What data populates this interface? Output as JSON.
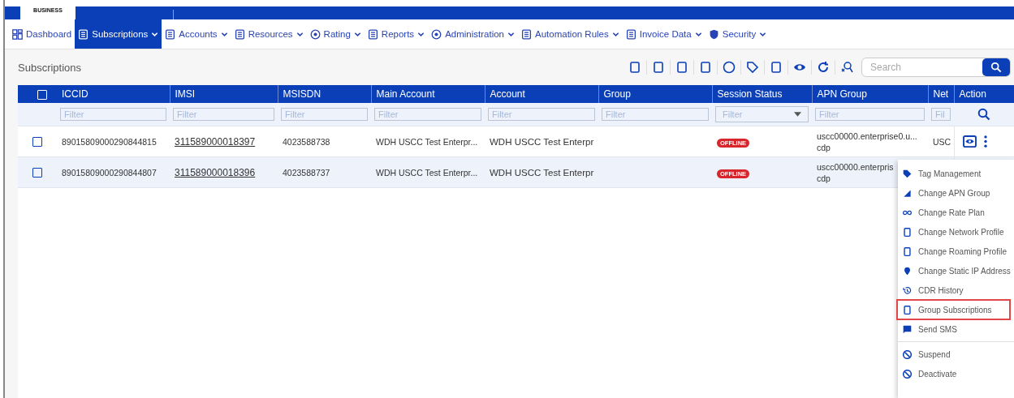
{
  "header": {
    "logo_text": "BUSINESS"
  },
  "nav": [
    {
      "label": "Dashboard",
      "selected": false,
      "has_menu": false
    },
    {
      "label": "Subscriptions",
      "selected": true,
      "has_menu": true
    },
    {
      "label": "Accounts",
      "selected": false,
      "has_menu": true
    },
    {
      "label": "Resources",
      "selected": false,
      "has_menu": true
    },
    {
      "label": "Rating",
      "selected": false,
      "has_menu": true
    },
    {
      "label": "Reports",
      "selected": false,
      "has_menu": true
    },
    {
      "label": "Administration",
      "selected": false,
      "has_menu": true
    },
    {
      "label": "Automation Rules",
      "selected": false,
      "has_menu": true
    },
    {
      "label": "Invoice Data",
      "selected": false,
      "has_menu": true
    },
    {
      "label": "Security",
      "selected": false,
      "has_menu": true
    }
  ],
  "panel": {
    "title": "Subscriptions",
    "search": {
      "placeholder": "Search"
    }
  },
  "table": {
    "select_all_checked": false,
    "columns": [
      {
        "label": "ICCID",
        "placeholder": "Filter",
        "kind": "text"
      },
      {
        "label": "IMSI",
        "placeholder": "Filter",
        "kind": "text"
      },
      {
        "label": "MSISDN",
        "placeholder": "Filter",
        "kind": "text"
      },
      {
        "label": "Main Account",
        "placeholder": "Filter",
        "kind": "text"
      },
      {
        "label": "Account",
        "placeholder": "Filter",
        "kind": "text"
      },
      {
        "label": "Group",
        "placeholder": "Filter",
        "kind": "text"
      },
      {
        "label": "Session Status",
        "placeholder": "Filter",
        "kind": "select"
      },
      {
        "label": "APN Group",
        "placeholder": "Filter",
        "kind": "text"
      },
      {
        "label": "Net",
        "placeholder": "Fil",
        "kind": "text"
      },
      {
        "label": "Action",
        "kind": "search"
      }
    ],
    "rows": [
      {
        "checked": false,
        "highlighted": false,
        "iccid": "89015809000290844815",
        "imsi": "311589000018397",
        "msisdn": "4023588738",
        "main_account": "WDH USCC Test Enterpr...",
        "account": "WDH USCC Test Enterpr",
        "status": "OFFLINE",
        "apn_group": [
          "uscc00000.enterprise0.u...",
          "cdp"
        ],
        "net": "USC",
        "actions_visible": true
      },
      {
        "checked": false,
        "highlighted": true,
        "iccid": "89015809000290844807",
        "imsi": "311589000018396",
        "msisdn": "4023588737",
        "main_account": "WDH USCC Test Enterpr...",
        "account": "WDH USCC Test Enterpr",
        "status": "OFFLINE",
        "apn_group": [
          "uscc00000.enterpris",
          "cdp"
        ],
        "net": "",
        "actions_visible": false
      }
    ]
  },
  "context_menu": {
    "items": [
      {
        "label": "Tag Management",
        "highlighted": false,
        "divider_before": false
      },
      {
        "label": "Change APN Group",
        "highlighted": false,
        "divider_before": false
      },
      {
        "label": "Change Rate Plan",
        "highlighted": false,
        "divider_before": false
      },
      {
        "label": "Change Network Profile",
        "highlighted": false,
        "divider_before": false
      },
      {
        "label": "Change Roaming Profile",
        "highlighted": false,
        "divider_before": false
      },
      {
        "label": "Change Static IP Address",
        "highlighted": false,
        "divider_before": false
      },
      {
        "label": "CDR History",
        "highlighted": false,
        "divider_before": false
      },
      {
        "label": "Group Subscriptions",
        "highlighted": true,
        "divider_before": false
      },
      {
        "label": "Send SMS",
        "highlighted": false,
        "divider_before": false
      },
      {
        "label": "Suspend",
        "highlighted": false,
        "divider_before": true
      },
      {
        "label": "Deactivate",
        "highlighted": false,
        "divider_before": false
      }
    ]
  }
}
